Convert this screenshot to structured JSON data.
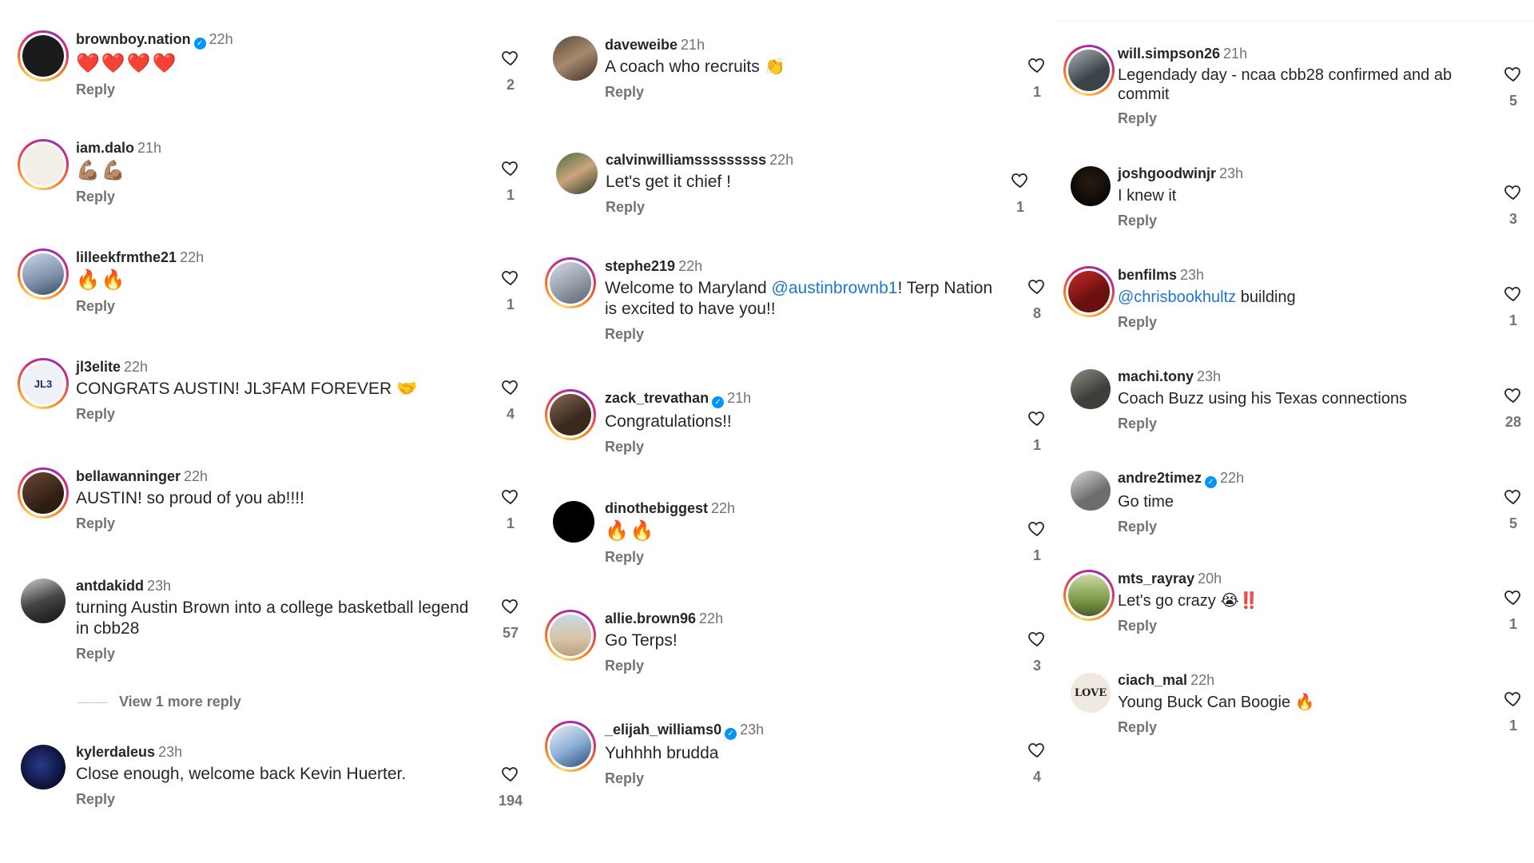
{
  "reply_label": "Reply",
  "col1": [
    {
      "user": "brownboy.nation",
      "verified": true,
      "time": "22h",
      "text": "❤️❤️❤️❤️",
      "likes": "2"
    },
    {
      "user": "iam.dalo",
      "verified": false,
      "time": "21h",
      "text": "💪🏽💪🏽",
      "likes": "1"
    },
    {
      "user": "lilleekfrmthe21",
      "verified": false,
      "time": "22h",
      "text": "🔥🔥",
      "likes": "1"
    },
    {
      "user": "jl3elite",
      "verified": false,
      "time": "22h",
      "text": "CONGRATS AUSTIN! JL3FAM FOREVER 🤝",
      "likes": "4",
      "avatar_text": "JL3"
    },
    {
      "user": "bellawanninger",
      "verified": false,
      "time": "22h",
      "text": "AUSTIN! so proud of you ab!!!!",
      "likes": "1"
    },
    {
      "user": "antdakidd",
      "verified": false,
      "time": "23h",
      "text": "turning Austin Brown into a college basketball legend in cbb28",
      "likes": "57",
      "view_more": "View 1 more reply"
    },
    {
      "user": "kylerdaleus",
      "verified": false,
      "time": "23h",
      "text": "Close enough, welcome back Kevin Huerter.",
      "likes": "194"
    }
  ],
  "col2": [
    {
      "user": "daveweibe",
      "verified": false,
      "time": "21h",
      "text": "A coach who recruits 👏",
      "likes": "1"
    },
    {
      "user": "calvinwilliamsssssssss",
      "verified": false,
      "time": "22h",
      "text": "Let's get it chief !",
      "likes": "1"
    },
    {
      "user": "stephe219",
      "verified": false,
      "time": "22h",
      "text_before": "Welcome to Maryland ",
      "mention": "@austinbrownb1",
      "text_after": "! Terp Nation is excited to have you!!",
      "likes": "8"
    },
    {
      "user": "zack_trevathan",
      "verified": true,
      "time": "21h",
      "text": "Congratulations!!",
      "likes": "1"
    },
    {
      "user": "dinothebiggest",
      "verified": false,
      "time": "22h",
      "text": "🔥🔥",
      "likes": "1"
    },
    {
      "user": "allie.brown96",
      "verified": false,
      "time": "22h",
      "text": "Go Terps!",
      "likes": "3"
    },
    {
      "user": "_elijah_williams0",
      "verified": true,
      "time": "23h",
      "text": "Yuhhhh brudda",
      "likes": "4"
    }
  ],
  "col3": [
    {
      "user": "will.simpson26",
      "verified": false,
      "time": "21h",
      "text": "Legendady day - ncaa cbb28 confirmed and ab commit",
      "likes": "5"
    },
    {
      "user": "joshgoodwinjr",
      "verified": false,
      "time": "23h",
      "text": "I knew it",
      "likes": "3"
    },
    {
      "user": "benfilms",
      "verified": false,
      "time": "23h",
      "mention": "@chrisbookhultz",
      "text_after": " building",
      "likes": "1"
    },
    {
      "user": "machi.tony",
      "verified": false,
      "time": "23h",
      "text": "Coach Buzz using his Texas connections",
      "likes": "28"
    },
    {
      "user": "andre2timez",
      "verified": true,
      "time": "22h",
      "text": "Go time",
      "likes": "5"
    },
    {
      "user": "mts_rayray",
      "verified": false,
      "time": "20h",
      "text": "Let's go crazy 😭‼️",
      "likes": "1"
    },
    {
      "user": "ciach_mal",
      "verified": false,
      "time": "22h",
      "text": "Young Buck Can Boogie 🔥",
      "likes": "1",
      "avatar_text": "LOVE"
    }
  ]
}
